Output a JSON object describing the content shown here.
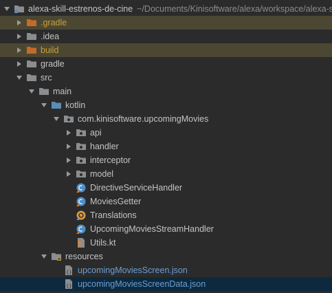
{
  "colors": {
    "background": "#2b2b2b",
    "excluded_highlight": "#4b4733",
    "selection": "#0d293e",
    "excluded_text": "#c9a235",
    "json_text": "#6a9fd4",
    "folder_grey": "#8b8e91",
    "folder_orange": "#c56b28",
    "folder_blue": "#5e8bb3"
  },
  "project": {
    "name": "alexa-skill-estrenos-de-cine",
    "path": "~/Documents/Kinisoftware/alexa/workspace/alexa-skill-estrenos-de-cine"
  },
  "tree": [
    {
      "label": ".gradle",
      "icon": "folder-excluded-icon",
      "expanded": false,
      "depth": 1
    },
    {
      "label": ".idea",
      "icon": "folder-icon",
      "expanded": false,
      "depth": 1
    },
    {
      "label": "build",
      "icon": "folder-excluded-icon",
      "expanded": false,
      "depth": 1
    },
    {
      "label": "gradle",
      "icon": "folder-icon",
      "expanded": false,
      "depth": 1
    },
    {
      "label": "src",
      "icon": "folder-icon",
      "expanded": true,
      "depth": 1
    },
    {
      "label": "main",
      "icon": "folder-icon",
      "expanded": true,
      "depth": 2
    },
    {
      "label": "kotlin",
      "icon": "source-folder-icon",
      "expanded": true,
      "depth": 3
    },
    {
      "label": "com.kinisoftware.upcomingMovies",
      "icon": "package-icon",
      "expanded": true,
      "depth": 4
    },
    {
      "label": "api",
      "icon": "package-icon",
      "expanded": false,
      "depth": 5
    },
    {
      "label": "handler",
      "icon": "package-icon",
      "expanded": false,
      "depth": 5
    },
    {
      "label": "interceptor",
      "icon": "package-icon",
      "expanded": false,
      "depth": 5
    },
    {
      "label": "model",
      "icon": "package-icon",
      "expanded": false,
      "depth": 5
    },
    {
      "label": "DirectiveServiceHandler",
      "icon": "kotlin-class-icon",
      "depth": 5
    },
    {
      "label": "MoviesGetter",
      "icon": "kotlin-class-icon",
      "depth": 5
    },
    {
      "label": "Translations",
      "icon": "kotlin-object-icon",
      "depth": 5
    },
    {
      "label": "UpcomingMoviesStreamHandler",
      "icon": "kotlin-class-icon",
      "depth": 5
    },
    {
      "label": "Utils.kt",
      "icon": "kotlin-file-icon",
      "depth": 5
    },
    {
      "label": "resources",
      "icon": "resources-folder-icon",
      "expanded": true,
      "depth": 3
    },
    {
      "label": "upcomingMoviesScreen.json",
      "icon": "json-file-icon",
      "depth": 4
    },
    {
      "label": "upcomingMoviesScreenData.json",
      "icon": "json-file-icon",
      "depth": 4,
      "selected": true
    }
  ]
}
